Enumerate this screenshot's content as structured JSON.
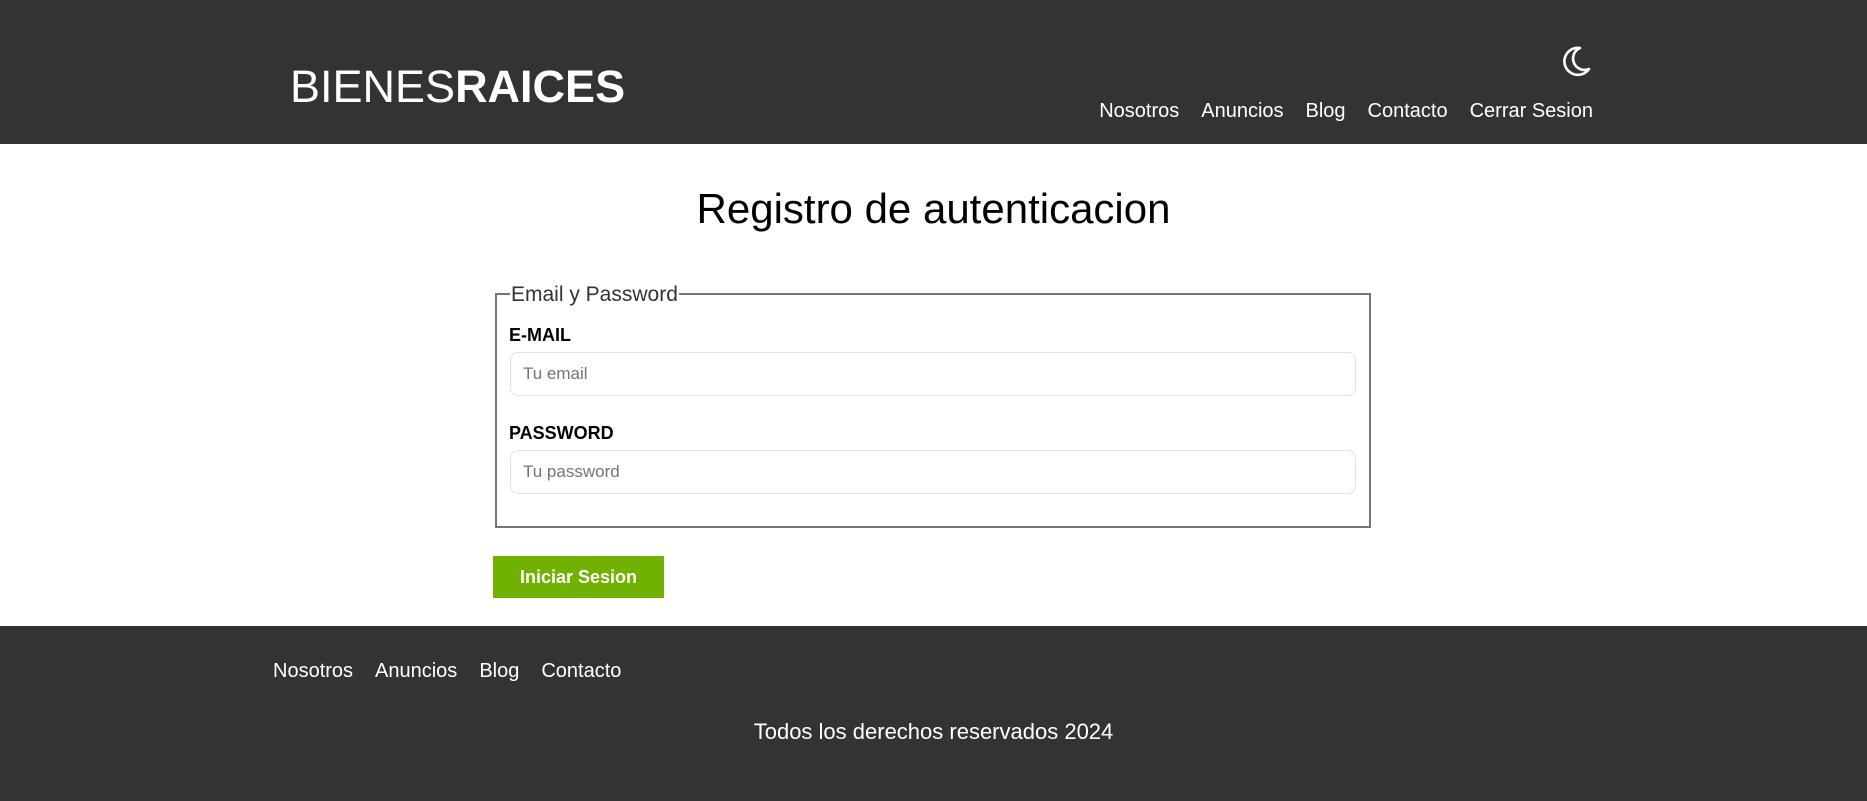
{
  "header": {
    "logo_light": "BIENES",
    "logo_bold": "RAICES",
    "theme_toggle_icon": "moon-icon",
    "nav": [
      {
        "label": "Nosotros"
      },
      {
        "label": "Anuncios"
      },
      {
        "label": "Blog"
      },
      {
        "label": "Contacto"
      },
      {
        "label": "Cerrar Sesion"
      }
    ]
  },
  "main": {
    "title": "Registro de autenticacion",
    "fieldset_legend": "Email y Password",
    "email_label": "E-MAIL",
    "email_placeholder": "Tu email",
    "email_value": "",
    "password_label": "PASSWORD",
    "password_placeholder": "Tu password",
    "password_value": "",
    "submit_label": "Iniciar Sesion"
  },
  "footer": {
    "nav": [
      {
        "label": "Nosotros"
      },
      {
        "label": "Anuncios"
      },
      {
        "label": "Blog"
      },
      {
        "label": "Contacto"
      }
    ],
    "copyright": "Todos los derechos reservados 2024"
  },
  "colors": {
    "header_bg": "#333333",
    "accent_green": "#71b100",
    "text_white": "#ffffff"
  }
}
